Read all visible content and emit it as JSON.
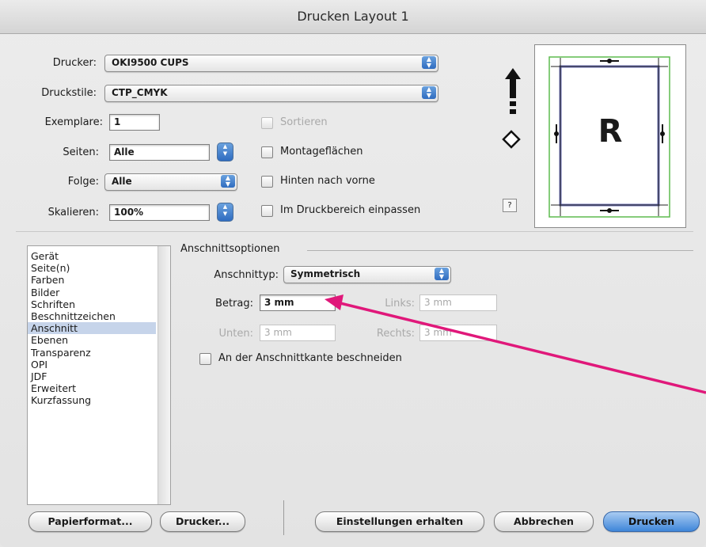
{
  "window": {
    "title": "Drucken Layout 1"
  },
  "top": {
    "drucker_label": "Drucker:",
    "drucker_value": "OKI9500 CUPS",
    "druckstile_label": "Druckstile:",
    "druckstile_value": "CTP_CMYK",
    "exemplare_label": "Exemplare:",
    "exemplare_value": "1",
    "seiten_label": "Seiten:",
    "seiten_value": "Alle",
    "folge_label": "Folge:",
    "folge_value": "Alle",
    "skalieren_label": "Skalieren:",
    "skalieren_value": "100%",
    "sortieren_label": "Sortieren",
    "montage_label": "Montageflächen",
    "hinten_label": "Hinten nach vorne",
    "einpassen_label": "Im Druckbereich einpassen"
  },
  "preview": {
    "letter": "R",
    "help": "?"
  },
  "sidebar": {
    "items": [
      "Gerät",
      "Seite(n)",
      "Farben",
      "Bilder",
      "Schriften",
      "Beschnittzeichen",
      "Anschnitt",
      "Ebenen",
      "Transparenz",
      "OPI",
      "JDF",
      "Erweitert",
      "Kurzfassung"
    ],
    "selected": "Anschnitt"
  },
  "panel": {
    "section_title": "Anschnittsoptionen",
    "typ_label": "Anschnittyp:",
    "typ_value": "Symmetrisch",
    "betrag_label": "Betrag:",
    "betrag_value": "3 mm",
    "links_label": "Links:",
    "links_value": "3 mm",
    "unten_label": "Unten:",
    "unten_value": "3 mm",
    "rechts_label": "Rechts:",
    "rechts_value": "3 mm",
    "beschneiden_label": "An der Anschnittkante beschneiden"
  },
  "buttons": {
    "papierformat": "Papierformat...",
    "drucker": "Drucker...",
    "einstellungen": "Einstellungen erhalten",
    "abbrechen": "Abbrechen",
    "drucken": "Drucken"
  },
  "colors": {
    "annotation_arrow": "#e0187a",
    "accent_blue": "#3f86d9"
  }
}
